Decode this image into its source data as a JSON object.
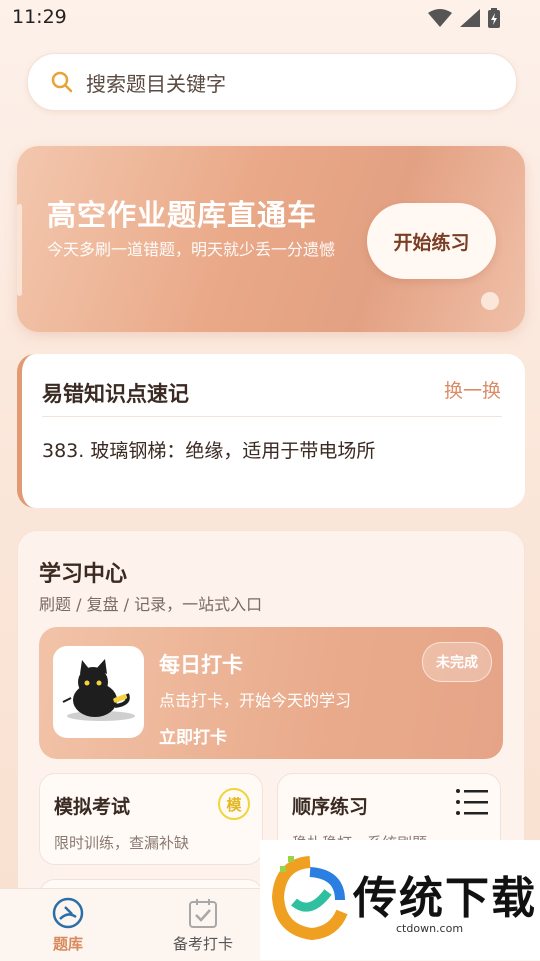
{
  "status": {
    "time": "11:29"
  },
  "search": {
    "placeholder": "搜索题目关键字"
  },
  "banner": {
    "title": "高空作业题库直通车",
    "subtitle": "今天多刷一道错题，明天就少丢一分遗憾",
    "button": "开始练习"
  },
  "tips": {
    "title": "易错知识点速记",
    "switch": "换一换",
    "content": "383. 玻璃钢梯：绝缘，适用于带电场所"
  },
  "center": {
    "title": "学习中心",
    "subtitle": "刷题 / 复盘 / 记录，一站式入口",
    "checkin": {
      "title": "每日打卡",
      "subtitle": "点击打卡，开始今天的学习",
      "link": "立即打卡",
      "badge": "未完成"
    },
    "cards": [
      {
        "title": "模拟考试",
        "subtitle": "限时训练，查漏补缺",
        "icon_text": "模"
      },
      {
        "title": "顺序练习",
        "subtitle": "稳扎稳打，系统刷题"
      }
    ]
  },
  "nav": {
    "items": [
      {
        "label": "题库",
        "active": true,
        "icon": "question-bank-icon"
      },
      {
        "label": "备考打卡",
        "active": false,
        "icon": "calendar-check-icon"
      }
    ]
  },
  "watermark": {
    "text": "传统下载",
    "url": "ctdown.com"
  },
  "colors": {
    "accent": "#e09a74",
    "active_nav": "#2a6fa8",
    "brand_text": "#7a3e24"
  }
}
